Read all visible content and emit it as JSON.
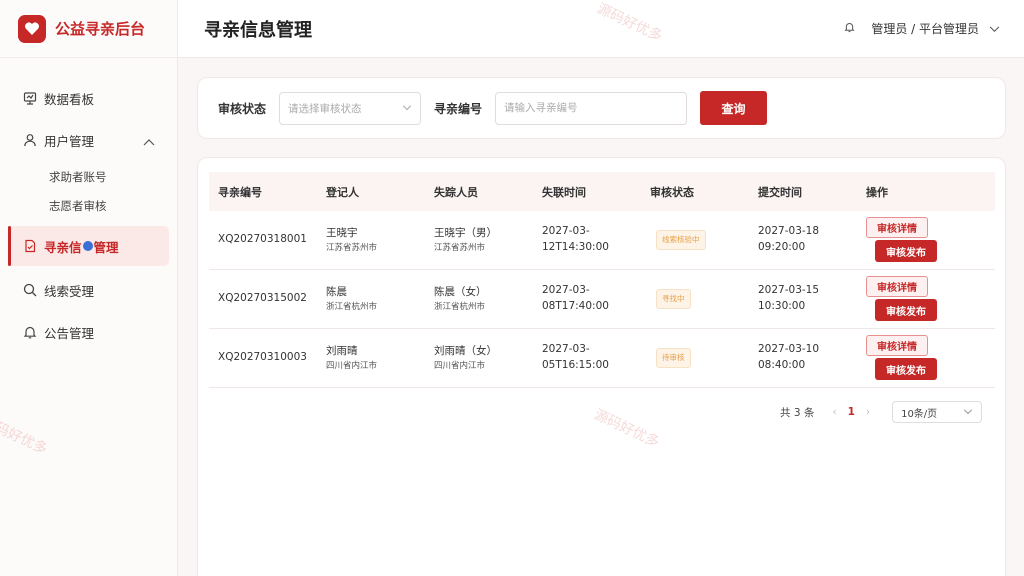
{
  "brand": {
    "name": "公益寻亲后台"
  },
  "sidebar": {
    "items": [
      {
        "label": "数据看板",
        "icon": "dashboard-icon"
      },
      {
        "label": "用户管理",
        "icon": "user-icon"
      },
      {
        "label": "求助者账号"
      },
      {
        "label": "志愿者审核"
      },
      {
        "label_a": "寻亲信",
        "label_b": "管理",
        "icon": "document-check-icon",
        "active": true
      },
      {
        "label": "线索受理",
        "icon": "search-icon"
      },
      {
        "label": "公告管理",
        "icon": "bell-icon"
      }
    ]
  },
  "header": {
    "title": "寻亲信息管理",
    "user": "管理员 / 平台管理员"
  },
  "filter": {
    "status_label": "审核状态",
    "status_placeholder": "请选择审核状态",
    "code_label": "寻亲编号",
    "code_placeholder": "请输入寻亲编号",
    "query_button": "查询"
  },
  "table": {
    "columns": [
      "寻亲编号",
      "登记人",
      "失踪人员",
      "失联时间",
      "审核状态",
      "提交时间",
      "操作"
    ],
    "rows": [
      {
        "code": "XQ20270318001",
        "registrant": "王晓宇",
        "registrant_loc": "江苏省苏州市",
        "missing": "王晓宇（男）",
        "missing_loc": "江苏省苏州市",
        "lost_l1": "2027-03-",
        "lost_l2": "12T14:30:00",
        "status": "线索核验中",
        "sub_l1": "2027-03-18",
        "sub_l2": "09:20:00",
        "detail": "审核详情",
        "publish": "审核发布"
      },
      {
        "code": "XQ20270315002",
        "registrant": "陈晨",
        "registrant_loc": "浙江省杭州市",
        "missing": "陈晨（女）",
        "missing_loc": "浙江省杭州市",
        "lost_l1": "2027-03-",
        "lost_l2": "08T17:40:00",
        "status": "寻找中",
        "sub_l1": "2027-03-15",
        "sub_l2": "10:30:00",
        "detail": "审核详情",
        "publish": "审核发布"
      },
      {
        "code": "XQ20270310003",
        "registrant": "刘雨晴",
        "registrant_loc": "四川省内江市",
        "missing": "刘雨晴（女）",
        "missing_loc": "四川省内江市",
        "lost_l1": "2027-03-",
        "lost_l2": "05T16:15:00",
        "status": "待审核",
        "sub_l1": "2027-03-10",
        "sub_l2": "08:40:00",
        "detail": "审核详情",
        "publish": "审核发布"
      }
    ]
  },
  "pagination": {
    "total": "共 3 条",
    "current": "1",
    "page_size": "10条/页"
  },
  "watermark": "源码好优多",
  "colors": {
    "accent": "#c62828",
    "badge": "#e7a04a"
  }
}
